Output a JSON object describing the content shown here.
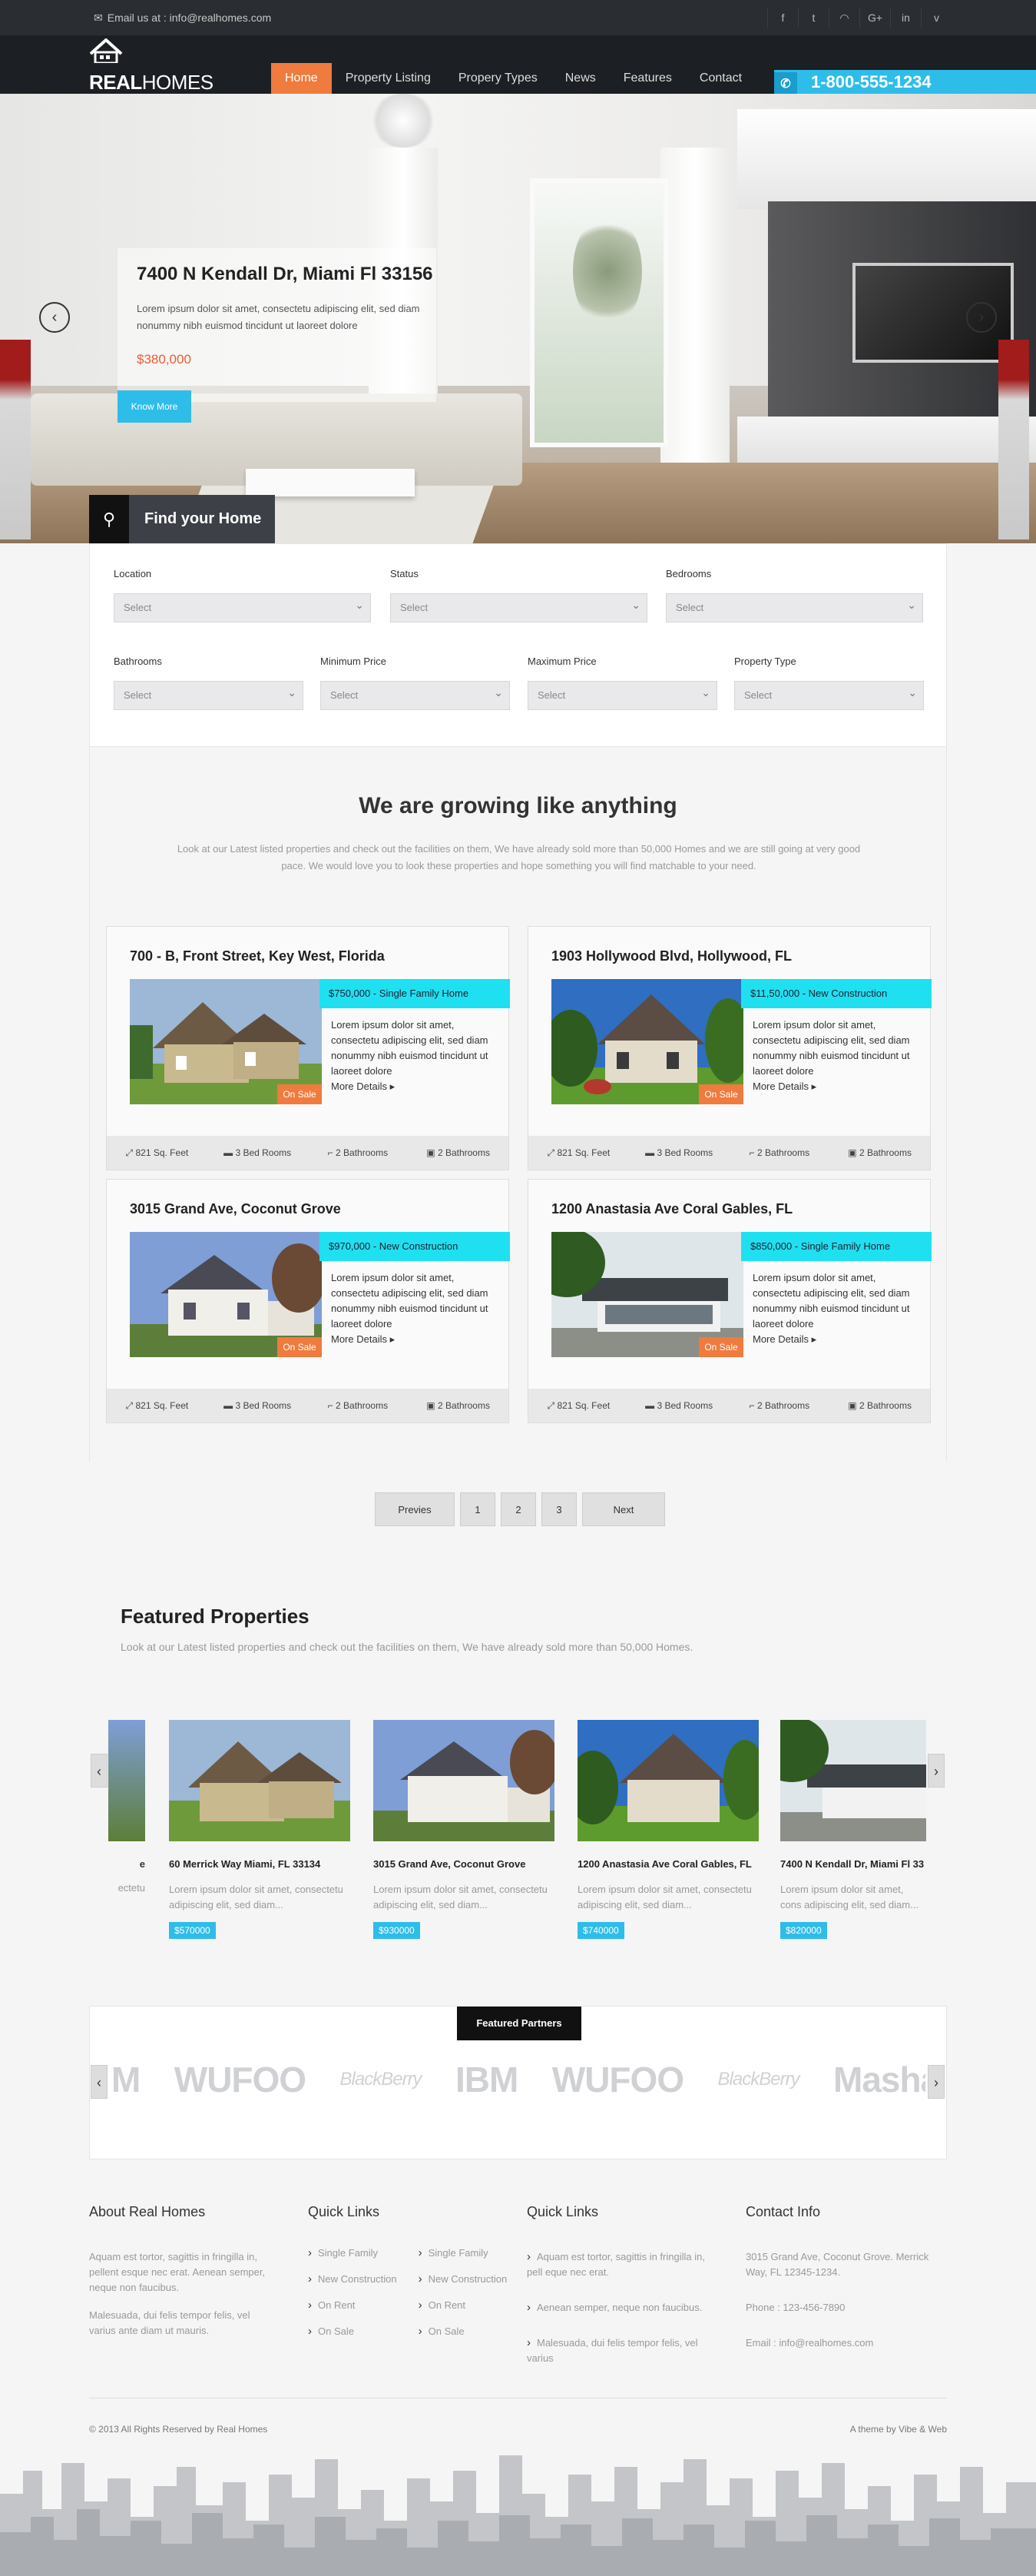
{
  "topbar": {
    "email_label": "Email us at : info@realhomes.com",
    "social_icons": [
      "facebook-icon",
      "twitter-icon",
      "rss-icon",
      "google-plus-icon",
      "linkedin-icon",
      "vimeo-icon"
    ],
    "social_glyphs": [
      "f",
      "t",
      "◠",
      "G+",
      "in",
      "v"
    ]
  },
  "brand": {
    "name_bold": "REAL",
    "name_light": "HOMES"
  },
  "nav": {
    "items": [
      "Home",
      "Property Listing",
      "Propery Types",
      "News",
      "Features",
      "Contact"
    ],
    "active": "Home"
  },
  "phone": {
    "number": "1-800-555-1234"
  },
  "hero": {
    "title": "7400 N Kendall Dr, Miami Fl 33156",
    "text": "Lorem ipsum dolor sit amet, consectetu adipiscing elit, sed diam nonummy nibh euismod tincidunt ut laoreet dolore",
    "price": "$380,000",
    "button": "Know More",
    "prev": "‹",
    "next": "›"
  },
  "find_home": {
    "label": "Find your Home"
  },
  "search": {
    "location_label": "Location",
    "status_label": "Status",
    "bedrooms_label": "Bedrooms",
    "bathrooms_label": "Bathrooms",
    "min_price_label": "Minimum Price",
    "max_price_label": "Maximum Price",
    "property_type_label": "Property Type",
    "select_text": "Select"
  },
  "growing": {
    "title": "We are growing like anything",
    "intro": "Look at our Latest listed properties and check out the facilities on them, We have already sold more than 50,000 Homes and we are still going at very good pace. We would love you to look these properties and hope something you will find matchable to your need."
  },
  "listings": [
    {
      "title": "700 - B, Front Street, Key West, Florida",
      "tag": "$750,000 - Single Family Home",
      "desc": "Lorem ipsum dolor sit amet, consectetu adipiscing elit, sed diam nonummy nibh euismod tincidunt ut laoreet dolore",
      "more": "More Details",
      "badge": "On Sale",
      "area": "821 Sq. Feet",
      "beds": "3 Bed Rooms",
      "baths": "2 Bathrooms",
      "garage": "2 Bathrooms"
    },
    {
      "title": "1903 Hollywood Blvd, Hollywood, FL",
      "tag": "$11,50,000 - New Construction",
      "desc": "Lorem ipsum dolor sit amet, consectetu adipiscing elit, sed diam nonummy nibh euismod tincidunt ut laoreet dolore",
      "more": "More Details",
      "badge": "On Sale",
      "area": "821 Sq. Feet",
      "beds": "3 Bed Rooms",
      "baths": "2 Bathrooms",
      "garage": "2 Bathrooms"
    },
    {
      "title": "3015 Grand Ave, Coconut Grove",
      "tag": "$970,000 - New Construction",
      "desc": "Lorem ipsum dolor sit amet, consectetu adipiscing elit, sed diam nonummy nibh euismod tincidunt ut laoreet dolore",
      "more": "More Details",
      "badge": "On Sale",
      "area": "821 Sq. Feet",
      "beds": "3 Bed Rooms",
      "baths": "2 Bathrooms",
      "garage": "2 Bathrooms"
    },
    {
      "title": "1200 Anastasia Ave Coral Gables, FL",
      "tag": "$850,000 - Single Family Home",
      "desc": "Lorem ipsum dolor sit amet, consectetu adipiscing elit, sed diam nonummy nibh euismod tincidunt ut laoreet dolore",
      "more": "More Details",
      "badge": "On Sale",
      "area": "821 Sq. Feet",
      "beds": "3 Bed Rooms",
      "baths": "2 Bathrooms",
      "garage": "2 Bathrooms"
    }
  ],
  "pagination": {
    "prev": "Previes",
    "pages": [
      "1",
      "2",
      "3"
    ],
    "next": "Next"
  },
  "featured": {
    "title": "Featured Properties",
    "subtitle": "Look at our Latest listed properties and check out the facilities on them, We have already sold more than 50,000 Homes.",
    "partial_left": {
      "title": "e",
      "desc": "ectetu"
    },
    "items": [
      {
        "title": "60 Merrick Way Miami, FL 33134",
        "desc": "Lorem ipsum dolor sit amet, consectetu adipiscing elit, sed diam...",
        "price": "$570000"
      },
      {
        "title": "3015 Grand Ave, Coconut Grove",
        "desc": "Lorem ipsum dolor sit amet, consectetu adipiscing elit, sed diam...",
        "price": "$930000"
      },
      {
        "title": "1200 Anastasia Ave Coral Gables, FL",
        "desc": "Lorem ipsum dolor sit amet, consectetu adipiscing elit, sed diam...",
        "price": "$740000"
      },
      {
        "title": "7400 N Kendall Dr, Miami Fl 33",
        "desc": "Lorem ipsum dolor sit amet, cons adipiscing elit, sed diam...",
        "price": "$820000"
      }
    ]
  },
  "partners": {
    "title": "Featured Partners",
    "logos": [
      "M",
      "WUFOO",
      "BlackBerry",
      "IBM",
      "WUFOO",
      "BlackBerry",
      "Masha"
    ]
  },
  "footer": {
    "about_title": "About Real Homes",
    "about_p1": "Aquam est tortor, sagittis in fringilla in, pellent esque nec erat. Aenean semper, neque non faucibus.",
    "about_p2": "Malesuada, dui felis tempor felis, vel varius ante diam ut mauris.",
    "quick1_title": "Quick Links",
    "quick1_col1": [
      "Single Family",
      "New Construction",
      "On Rent",
      "On Sale"
    ],
    "quick1_col2": [
      "Single Family",
      "New Construction",
      "On Rent",
      "On Sale"
    ],
    "quick2_title": "Quick Links",
    "quick2_items": [
      "Aquam est tortor, sagittis in fringilla in, pell eque nec erat.",
      "Aenean semper, neque non faucibus.",
      "Malesuada, dui felis tempor felis, vel varius"
    ],
    "contact_title": "Contact Info",
    "contact_address": "3015 Grand Ave, Coconut Grove. Merrick Way, FL 12345-1234.",
    "contact_phone": "Phone : 123-456-7890",
    "contact_email": "Email : info@realhomes.com",
    "copyright": "© 2013 All Rights Reserved by Real Homes",
    "credit": "A theme by Vibe & Web"
  },
  "colors": {
    "accent_orange": "#ef7b3e",
    "accent_blue": "#2ebde9",
    "tag_cyan": "#1fe0f0",
    "dark": "#1c1f23"
  }
}
